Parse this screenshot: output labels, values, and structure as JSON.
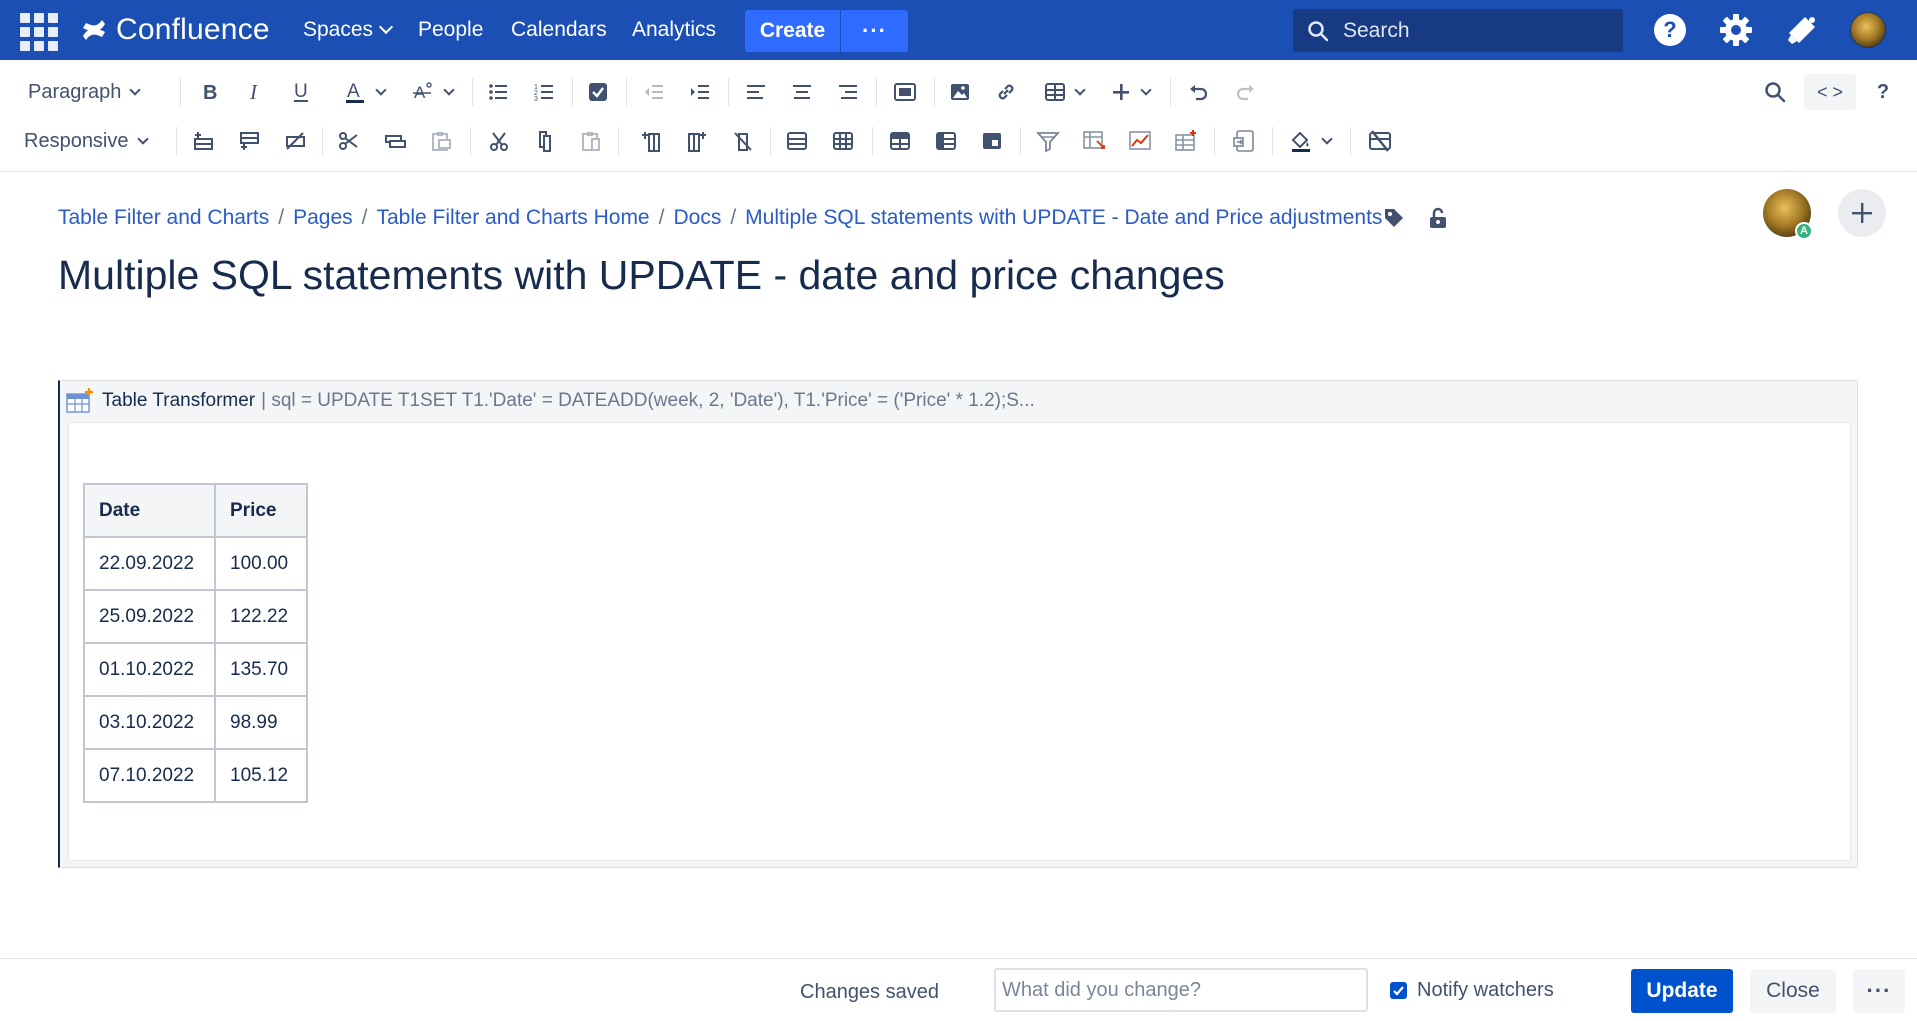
{
  "topnav": {
    "brand": "Confluence",
    "links": {
      "spaces": "Spaces",
      "people": "People",
      "calendars": "Calendars",
      "analytics": "Analytics"
    },
    "create": "Create",
    "more": "···",
    "search_placeholder": "Search",
    "colors": {
      "bar": "#1c4fb3",
      "button": "#2f6bff"
    }
  },
  "toolbar": {
    "paragraph": "Paragraph",
    "responsive": "Responsive",
    "code": "< >",
    "help": "?"
  },
  "breadcrumb": {
    "items": [
      "Table Filter and Charts",
      "Pages",
      "Table Filter and Charts Home",
      "Docs",
      "Multiple SQL statements with UPDATE - Date and Price adjustments"
    ],
    "separator": "/"
  },
  "page": {
    "title": "Multiple SQL statements with UPDATE - date and price changes",
    "avatar_badge": "A"
  },
  "macro": {
    "name": "Table Transformer",
    "params": "| sql = UPDATE T1SET T1.'Date' = DATEADD(week, 2, 'Date'), T1.'Price' = ('Price' * 1.2);S...",
    "table": {
      "headers": [
        "Date",
        "Price"
      ],
      "rows": [
        [
          "22.09.2022",
          "100.00"
        ],
        [
          "25.09.2022",
          "122.22"
        ],
        [
          "01.10.2022",
          "135.70"
        ],
        [
          "03.10.2022",
          "98.99"
        ],
        [
          "07.10.2022",
          "105.12"
        ]
      ]
    }
  },
  "footer": {
    "status": "Changes saved",
    "change_placeholder": "What did you change?",
    "notify_label": "Notify watchers",
    "notify_checked": true,
    "update": "Update",
    "close": "Close",
    "more": "···",
    "colors": {
      "primary": "#0052cc"
    }
  }
}
